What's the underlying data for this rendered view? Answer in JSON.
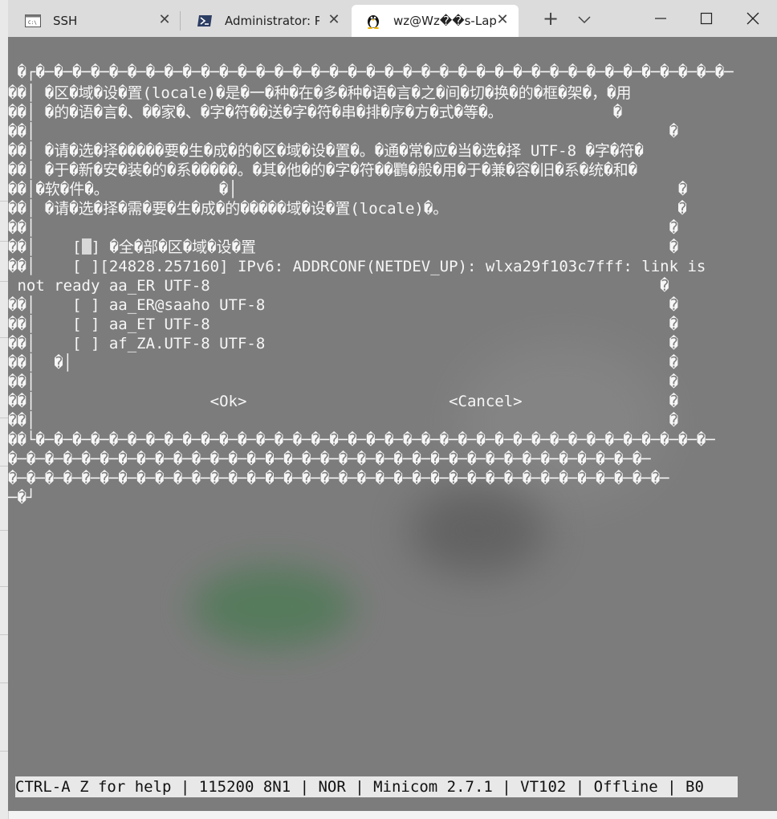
{
  "tabs": [
    {
      "label": "SSH",
      "icon": "terminal-window-icon",
      "active": false
    },
    {
      "label": "Administrator: Pov",
      "icon": "powershell-icon",
      "active": false
    },
    {
      "label": "wz@Wz��s-Lap",
      "icon": "linux-penguin-icon",
      "active": true
    }
  ],
  "tabbar": {
    "new_tab": "+"
  },
  "terminal": {
    "lines": [
      " �┌�─�─�─�─�─�─�─�─�─�─�─�─�─�─�─�─�─�─�─�─�─�─�─�─�─�─�─�─�─�─�─�─�─�─�─�─�─�─",
      "��│ �区�域�设�置(locale)�是�一�种�在�多�种�语�言�之�间�切�换�的�框�架�，�用",
      "��│ �的�语�言�、��家�、�字�符��送�字�符�串�排�序�方�式�等�。            �",
      "��│                                                                     �",
      "��│ �请�选�择�����要�生�成�的�区�域�设�置�。�通�常�应�当�选�择 UTF-8 �字�符�",
      "��│ �于�新�安�装�的�系�����。�其�他�的�字�符��鸜�般�用�于�兼�容�旧�系�统�和�",
      "��│�软�件�。            �│                                                �",
      "��│ �请�选�择�需�要�生�成�的�����域�设�置(locale)�。                         �",
      "��│                                                                     �",
      "��│    [",
      "��│    [ ][24828.257160] IPv6: ADDRCONF(NETDEV_UP): wlxa29f103c7fff: link is",
      " not ready aa_ER UTF-8                                                 �",
      "��│    [ ] aa_ER@saaho UTF-8                                            �",
      "��│    [ ] aa_ET UTF-8                                                  �",
      "��│    [ ] af_ZA.UTF-8 UTF-8                                            �",
      "��│  �│                                                                 �",
      "��│                                                                     �",
      "��│                   <Ok>                      <Cancel>                �",
      "��│                                                                     �",
      "��└�─�─�─�─�─�─�─�─�─�─�─�─�─�─�─�─�─�─�─�─�─�─�─�─�─�─�─�─�─�─�─�─�─�─�─�─�─",
      "�─�─�─�─�─�─�─�─�─�─�─�─�─�─�─�─�─�─�─�─�─�─�─�─�─�─�─�─�─�─�─�─�─�─�─",
      "�─�─�─�─�─�─�─�─�─�─�─�─�─�─�─�─�─�─�─�─�─�─�─�─�─�─�─�─�─�─�─�─�─�─�─�─",
      "─�┘"
    ],
    "checkbox_line_tail": "] �全�部�区�域�设�置                                             �",
    "status": "CTRL-A Z for help | 115200 8N1 | NOR | Minicom 2.7.1 | VT102 | Offline | B0"
  },
  "colors": {
    "terminal_bg": "#7c7c7c",
    "tabbar_bg": "#dcdcdc",
    "status_bg": "#e8e8e8"
  }
}
